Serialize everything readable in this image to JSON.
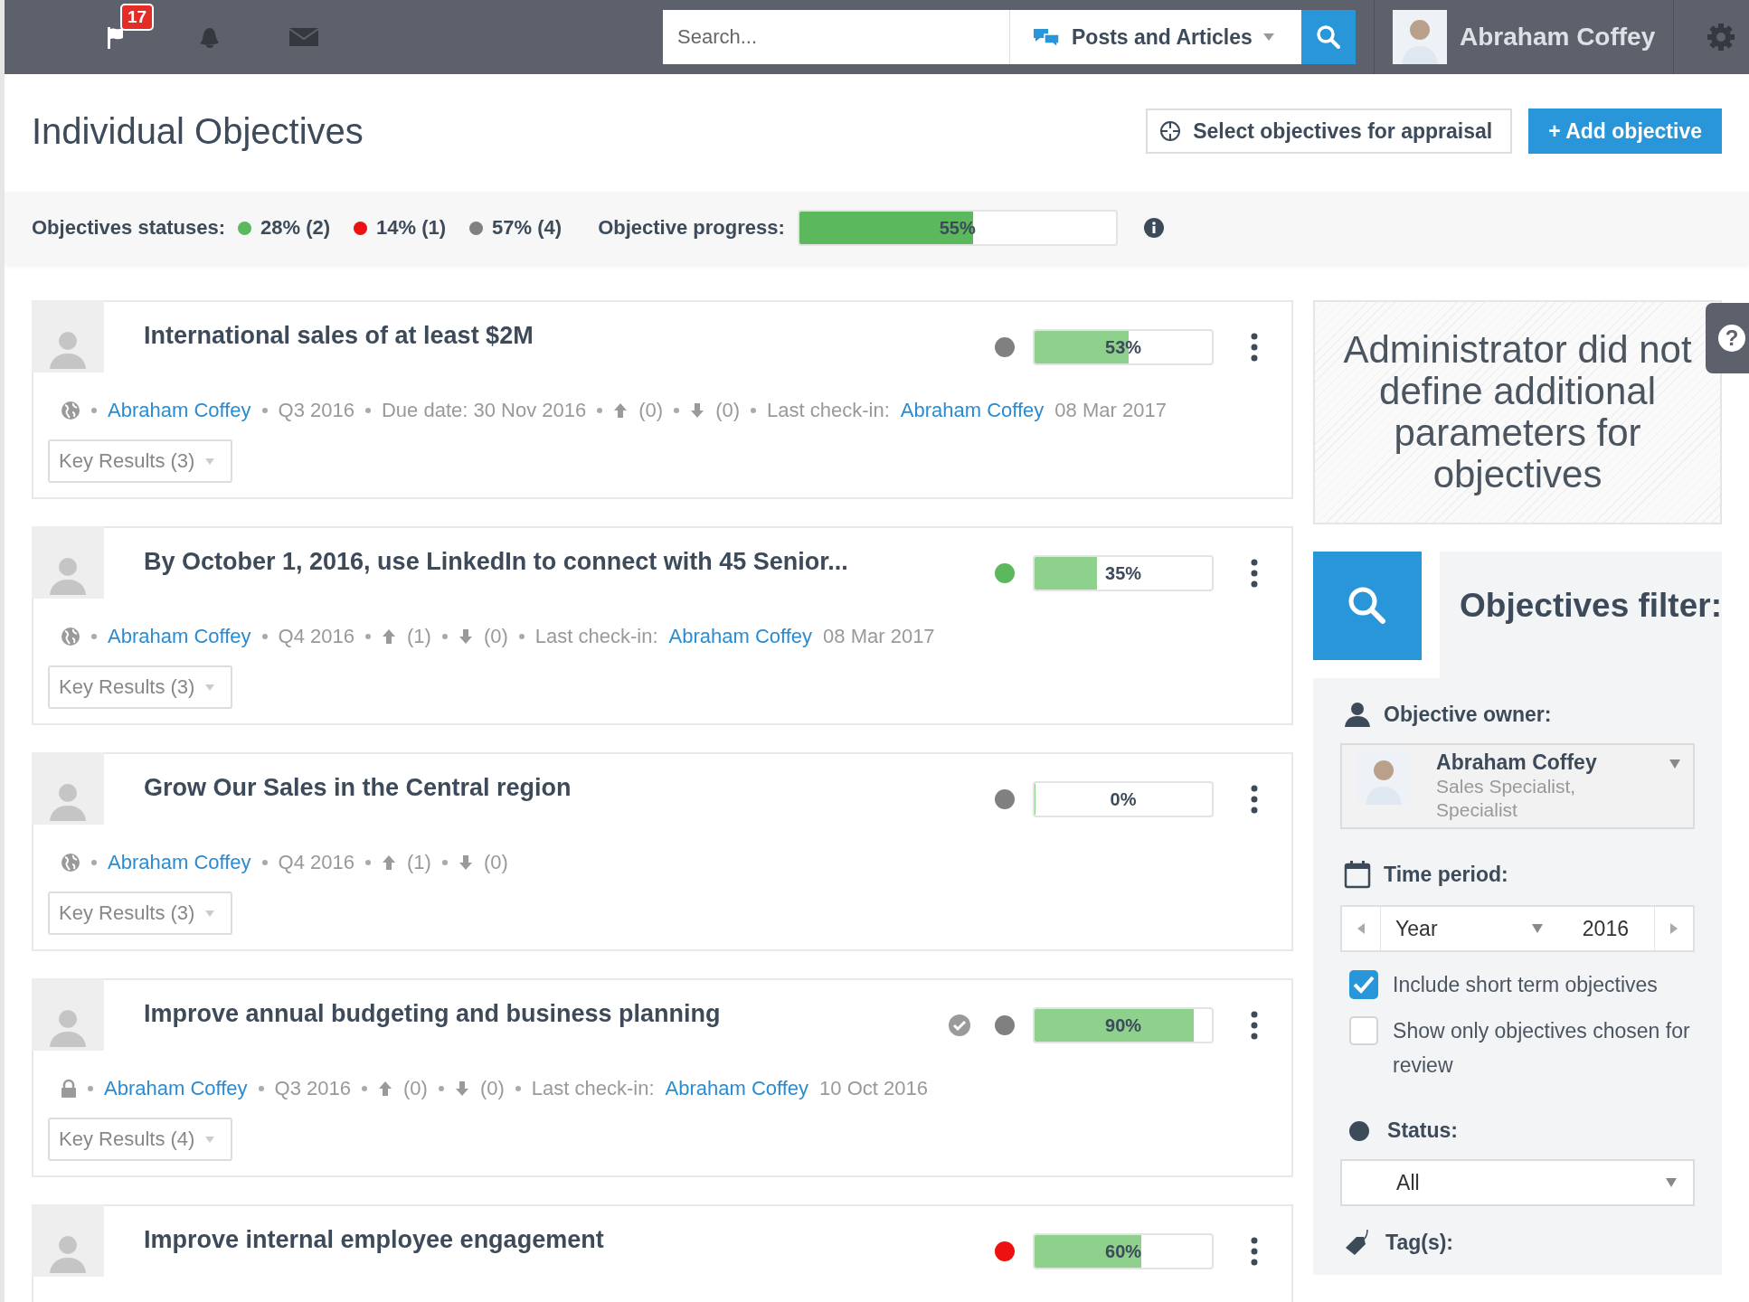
{
  "topbar": {
    "notifications_badge": "17",
    "search": {
      "placeholder": "Search..."
    },
    "scope": "Posts and Articles",
    "user": "Abraham Coffey"
  },
  "header": {
    "title": "Individual Objectives",
    "appraisal_button": "Select objectives for appraisal",
    "add_button": "+ Add objective"
  },
  "stats": {
    "label": "Objectives statuses:",
    "statuses": [
      {
        "color": "#5cb85c",
        "text": "28% (2)"
      },
      {
        "color": "#ee1111",
        "text": "14% (1)"
      },
      {
        "color": "#808080",
        "text": "57% (4)"
      }
    ],
    "progress_label": "Objective progress:",
    "progress": {
      "level": 0.55,
      "reading": "55%"
    }
  },
  "objectives": [
    {
      "title": "International sales of at least $2M",
      "reviewed": false,
      "color": "#808080",
      "level": 0.53,
      "reading": "53%",
      "kind": "public",
      "meta": [
        {
          "kind": "link",
          "text": "Abraham Coffey"
        },
        {
          "kind": "text",
          "text": "Q3 2016"
        },
        {
          "kind": "text",
          "text": "Due date: 30 Nov 2016"
        },
        {
          "kind": "up",
          "text": "(0)"
        },
        {
          "kind": "down",
          "text": "(0)"
        },
        {
          "kind": "checkin",
          "label": "Last check-in:",
          "by": "Abraham Coffey",
          "date": "08 Mar 2017"
        }
      ],
      "key_results": "Key Results (3)"
    },
    {
      "title": "By October 1, 2016, use LinkedIn to connect with 45 Senior...",
      "reviewed": false,
      "color": "#5cb85c",
      "level": 0.35,
      "reading": "35%",
      "kind": "public",
      "meta": [
        {
          "kind": "link",
          "text": "Abraham Coffey"
        },
        {
          "kind": "text",
          "text": "Q4 2016"
        },
        {
          "kind": "up",
          "text": "(1)"
        },
        {
          "kind": "down",
          "text": "(0)"
        },
        {
          "kind": "checkin",
          "label": "Last check-in:",
          "by": "Abraham Coffey",
          "date": "08 Mar 2017"
        }
      ],
      "key_results": "Key Results (3)"
    },
    {
      "title": "Grow Our Sales in the Central region",
      "reviewed": false,
      "color": "#808080",
      "level": 0,
      "reading": "0%",
      "kind": "public",
      "meta": [
        {
          "kind": "link",
          "text": "Abraham Coffey"
        },
        {
          "kind": "text",
          "text": "Q4 2016"
        },
        {
          "kind": "up",
          "text": "(1)"
        },
        {
          "kind": "down",
          "text": "(0)"
        }
      ],
      "key_results": "Key Results (3)"
    },
    {
      "title": "Improve annual budgeting and business planning",
      "reviewed": true,
      "color": "#808080",
      "level": 0.9,
      "reading": "90%",
      "kind": "private",
      "meta": [
        {
          "kind": "link",
          "text": "Abraham Coffey"
        },
        {
          "kind": "text",
          "text": "Q3 2016"
        },
        {
          "kind": "up",
          "text": "(0)"
        },
        {
          "kind": "down",
          "text": "(0)"
        },
        {
          "kind": "checkin",
          "label": "Last check-in:",
          "by": "Abraham Coffey",
          "date": "10 Oct 2016"
        }
      ],
      "key_results": "Key Results (4)"
    },
    {
      "title": "Improve internal employee engagement",
      "reviewed": false,
      "color": "#ee1111",
      "level": 0.6,
      "reading": "60%"
    }
  ],
  "notice": "Administrator did not define additional parameters for objectives",
  "help": "?",
  "filter": {
    "title": "Objectives filter:",
    "owner_label": "Objective owner:",
    "owner": {
      "name": "Abraham Coffey",
      "role": "Sales Specialist, Specialist"
    },
    "period_label": "Time period:",
    "period": {
      "unit": "Year",
      "value": "2016"
    },
    "options": [
      {
        "label": "Include short term objectives",
        "checked": true
      },
      {
        "label": "Show only objectives chosen for review",
        "checked": false
      }
    ],
    "status_label": "Status:",
    "status": "All",
    "tags_label": "Tag(s):"
  }
}
